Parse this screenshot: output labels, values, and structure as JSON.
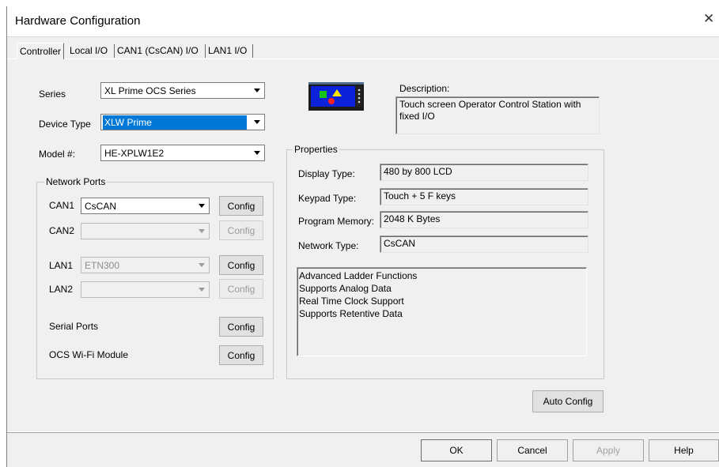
{
  "window": {
    "title": "Hardware Configuration",
    "close_glyph": "✕"
  },
  "tabs": [
    {
      "label": "Controller",
      "active": true
    },
    {
      "label": "Local I/O"
    },
    {
      "label": "CAN1 (CsCAN) I/O"
    },
    {
      "label": "LAN1 I/O"
    }
  ],
  "device": {
    "series_label": "Series",
    "series_value": "XL Prime OCS Series",
    "device_type_label": "Device Type",
    "device_type_value": "XLW Prime",
    "model_label": "Model #:",
    "model_value": "HE-XPLW1E2"
  },
  "network_ports": {
    "title": "Network Ports",
    "can1": {
      "label": "CAN1",
      "value": "CsCAN",
      "config": "Config"
    },
    "can2": {
      "label": "CAN2",
      "value": "",
      "config": "Config"
    },
    "lan1": {
      "label": "LAN1",
      "value": "ETN300",
      "config": "Config"
    },
    "lan2": {
      "label": "LAN2",
      "value": "",
      "config": "Config"
    },
    "serial": {
      "label": "Serial Ports",
      "config": "Config"
    },
    "wifi": {
      "label": "OCS Wi-Fi Module",
      "config": "Config"
    }
  },
  "description": {
    "label": "Description:",
    "text": "Touch screen Operator Control Station with fixed I/O"
  },
  "properties": {
    "title": "Properties",
    "display_type_label": "Display Type:",
    "display_type_value": "480 by 800 LCD",
    "keypad_type_label": "Keypad Type:",
    "keypad_type_value": "Touch + 5 F keys",
    "program_memory_label": "Program Memory:",
    "program_memory_value": "2048 K Bytes",
    "network_type_label": "Network Type:",
    "network_type_value": "CsCAN",
    "features": [
      "Advanced Ladder Functions",
      "Supports Analog Data",
      "Real Time Clock Support",
      "Supports Retentive Data"
    ]
  },
  "actions": {
    "auto_config": "Auto Config",
    "ok": "OK",
    "cancel": "Cancel",
    "apply": "Apply",
    "help": "Help"
  },
  "colors": {
    "selection": "#0078d7",
    "dialog_bg": "#f0f0f0"
  },
  "icons": {
    "device_image": "ocs-device-icon"
  }
}
